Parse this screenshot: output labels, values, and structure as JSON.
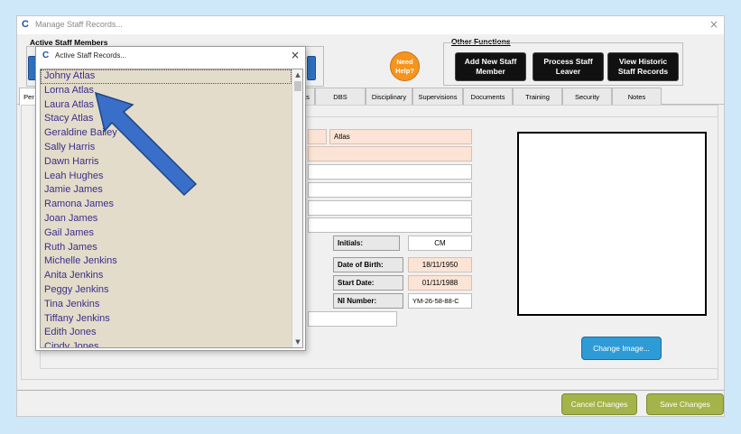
{
  "window": {
    "logo": "C",
    "title": "Manage Staff Records...",
    "close": "×"
  },
  "header": {
    "active_staff_label": "Active Staff Members",
    "other_functions_label": "Other Functions",
    "need_help": "Need Help?",
    "buttons": {
      "add_new": "Add New Staff Member",
      "process_leaver": "Process Staff Leaver",
      "view_historic": "View Historic Staff Records"
    }
  },
  "tabs": [
    {
      "label": "Per"
    },
    {
      "label": "s"
    },
    {
      "label": "DBS"
    },
    {
      "label": "Disciplinary"
    },
    {
      "label": "Supervisions"
    },
    {
      "label": "Documents"
    },
    {
      "label": "Training"
    },
    {
      "label": "Security"
    },
    {
      "label": "Notes"
    }
  ],
  "form": {
    "surname_value": "Atlas",
    "initials_label": "Initials:",
    "initials_value": "CM",
    "dob_label": "Date of Birth:",
    "dob_value": "18/11/1950",
    "start_label": "Start Date:",
    "start_value": "01/11/1988",
    "ni_label": "NI Number:",
    "ni_value": "YM-26-58-88-C"
  },
  "photo": {
    "change_image": "Change Image..."
  },
  "footer": {
    "cancel": "Cancel Changes",
    "save": "Save Changes"
  },
  "popup": {
    "logo": "C",
    "title": "Active Staff Records...",
    "close": "×",
    "items": [
      "Johny Atlas",
      "Lorna Atlas",
      "Laura Atlas",
      "Stacy Atlas",
      "Geraldine Bailey",
      "Sally Harris",
      "Dawn Harris",
      "Leah Hughes",
      "Jamie James",
      "Ramona James",
      "Joan James",
      "Gail James",
      "Ruth James",
      "Michelle Jenkins",
      "Anita Jenkins",
      "Peggy Jenkins",
      "Tina Jenkins",
      "Tiffany Jenkins",
      "Edith Jones",
      "Cindy Jones"
    ],
    "selected_index": 0
  },
  "colors": {
    "arrow": "#3a6fc9",
    "arrow_outline": "#1e4486",
    "list_bg": "#e3dcca",
    "field_peach": "#fbe4d5",
    "green_button": "#a5b44a",
    "blue_button": "#2e9bd6",
    "need_help": "#f7941d"
  },
  "icons": {
    "annotation_arrow": "arrow-pointing-up-left-icon"
  }
}
